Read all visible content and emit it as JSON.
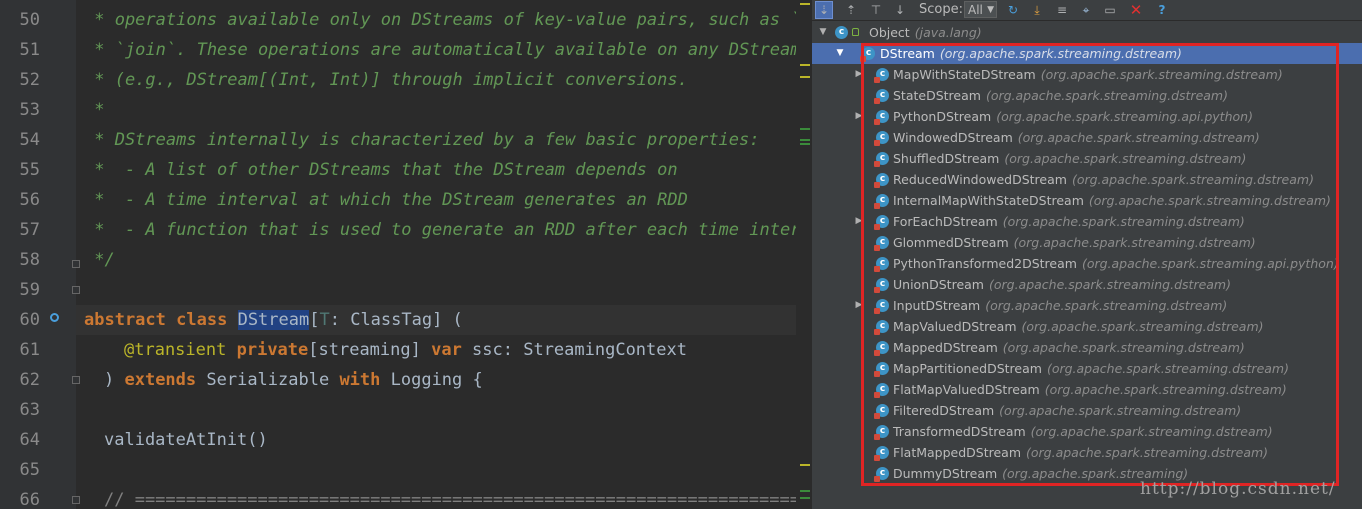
{
  "editor": {
    "line_numbers": [
      "50",
      "51",
      "52",
      "53",
      "54",
      "55",
      "56",
      "57",
      "58",
      "59",
      "60",
      "61",
      "62",
      "63",
      "64",
      "65",
      "66"
    ],
    "lines": {
      "l50": " * operations available only on DStreams of key-value pairs, such as `groupByKey` and",
      "l51": " * `join`. These operations are automatically available on any DStream of pairs",
      "l52": " * (e.g., DStream[(Int, Int)] through implicit conversions.",
      "l53": " *",
      "l54": " * DStreams internally is characterized by a few basic properties:",
      "l55": " *  - A list of other DStreams that the DStream depends on",
      "l56": " *  - A time interval at which the DStream generates an RDD",
      "l57": " *  - A function that is used to generate an RDD after each time interval",
      "l58": " */",
      "l60_kw1": "abstract",
      "l60_kw2": "class",
      "l60_name": "DStream",
      "l60_open": "[",
      "l60_tparam": "T",
      "l60_rest": ": ClassTag] (",
      "l61_ann": "@transient",
      "l61_kw1": "private",
      "l61_mid": "[streaming] ",
      "l61_kw2": "var",
      "l61_rest": " ssc: StreamingContext",
      "l62_pre": ") ",
      "l62_kw1": "extends",
      "l62_mid": " Serializable ",
      "l62_kw2": "with",
      "l62_rest": " Logging {",
      "l64": "validateAtInit()",
      "l66": "// =========================================================================="
    }
  },
  "hierarchy": {
    "toolbar": {
      "scope_label": "Scope:",
      "scope_value": "All",
      "buttons": [
        "subtypes-hierarchy-icon",
        "supertypes-hierarchy-icon",
        "class-hierarchy-icon",
        "sort-alpha-icon",
        "refresh-icon",
        "export-icon",
        "expand-all-icon",
        "pin-icon",
        "close-icon",
        "help-icon"
      ]
    },
    "root": {
      "name": "Object",
      "pkg": "(java.lang)"
    },
    "selected": {
      "name": "DStream",
      "pkg": "(org.apache.spark.streaming.dstream)"
    },
    "children": [
      {
        "name": "MapWithStateDStream",
        "pkg": "(org.apache.spark.streaming.dstream)",
        "expandable": true
      },
      {
        "name": "StateDStream",
        "pkg": "(org.apache.spark.streaming.dstream)",
        "expandable": false
      },
      {
        "name": "PythonDStream",
        "pkg": "(org.apache.spark.streaming.api.python)",
        "expandable": true
      },
      {
        "name": "WindowedDStream",
        "pkg": "(org.apache.spark.streaming.dstream)",
        "expandable": false
      },
      {
        "name": "ShuffledDStream",
        "pkg": "(org.apache.spark.streaming.dstream)",
        "expandable": false
      },
      {
        "name": "ReducedWindowedDStream",
        "pkg": "(org.apache.spark.streaming.dstream)",
        "expandable": false
      },
      {
        "name": "InternalMapWithStateDStream",
        "pkg": "(org.apache.spark.streaming.dstream)",
        "expandable": false
      },
      {
        "name": "ForEachDStream",
        "pkg": "(org.apache.spark.streaming.dstream)",
        "expandable": true
      },
      {
        "name": "GlommedDStream",
        "pkg": "(org.apache.spark.streaming.dstream)",
        "expandable": false
      },
      {
        "name": "PythonTransformed2DStream",
        "pkg": "(org.apache.spark.streaming.api.python)",
        "expandable": false
      },
      {
        "name": "UnionDStream",
        "pkg": "(org.apache.spark.streaming.dstream)",
        "expandable": false
      },
      {
        "name": "InputDStream",
        "pkg": "(org.apache.spark.streaming.dstream)",
        "expandable": true
      },
      {
        "name": "MapValuedDStream",
        "pkg": "(org.apache.spark.streaming.dstream)",
        "expandable": false
      },
      {
        "name": "MappedDStream",
        "pkg": "(org.apache.spark.streaming.dstream)",
        "expandable": false
      },
      {
        "name": "MapPartitionedDStream",
        "pkg": "(org.apache.spark.streaming.dstream)",
        "expandable": false
      },
      {
        "name": "FlatMapValuedDStream",
        "pkg": "(org.apache.spark.streaming.dstream)",
        "expandable": false
      },
      {
        "name": "FilteredDStream",
        "pkg": "(org.apache.spark.streaming.dstream)",
        "expandable": false
      },
      {
        "name": "TransformedDStream",
        "pkg": "(org.apache.spark.streaming.dstream)",
        "expandable": false
      },
      {
        "name": "FlatMappedDStream",
        "pkg": "(org.apache.spark.streaming.dstream)",
        "expandable": false
      },
      {
        "name": "DummyDStream",
        "pkg": "(org.apache.spark.streaming)",
        "expandable": false
      }
    ]
  },
  "watermark": "http://blog.csdn.net/",
  "colors": {
    "highlight_box": "#e02424",
    "selection": "#4b6eaf"
  }
}
